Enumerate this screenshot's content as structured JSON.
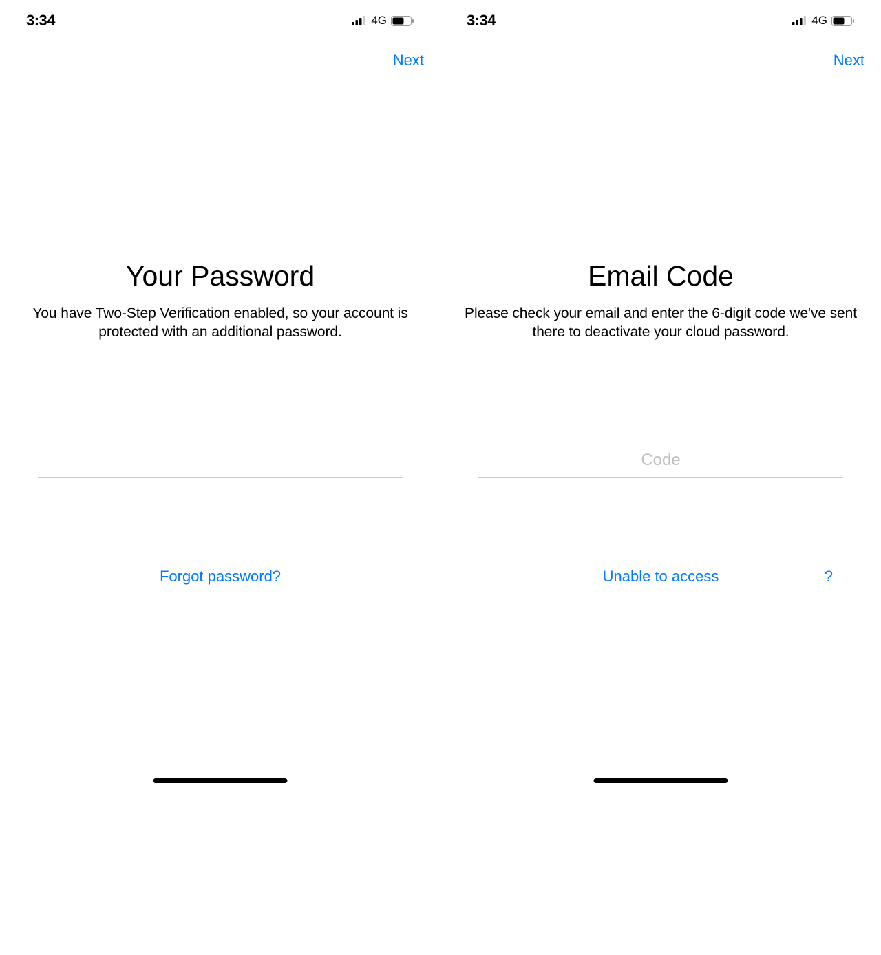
{
  "status": {
    "time": "3:34",
    "network": "4G"
  },
  "nav": {
    "next": "Next"
  },
  "left": {
    "title": "Your Password",
    "subtitle": "You have Two-Step Verification enabled, so your account is protected with an additional password.",
    "forgot": "Forgot password?"
  },
  "right": {
    "title": "Email Code",
    "subtitle": "Please check your email and enter the 6-digit code we've sent there to deactivate your cloud password.",
    "placeholder": "Code",
    "unable": "Unable to access",
    "help": "?"
  }
}
